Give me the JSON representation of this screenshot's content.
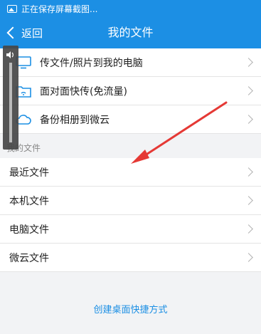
{
  "status_bar": {
    "text": "正在保存屏幕截图..."
  },
  "header": {
    "back_label": "返回",
    "title": "我的文件"
  },
  "transfer_items": [
    {
      "label": "传文件/照片到我的电脑",
      "icon": "monitor-icon"
    },
    {
      "label": "面对面快传(免流量)",
      "icon": "wifi-folder-icon"
    },
    {
      "label": "备份相册到微云",
      "icon": "cloud-icon"
    }
  ],
  "section_label": "我的文件",
  "file_items": [
    {
      "label": "最近文件"
    },
    {
      "label": "本机文件"
    },
    {
      "label": "电脑文件"
    },
    {
      "label": "微云文件"
    }
  ],
  "footer_link": "创建桌面快捷方式",
  "colors": {
    "accent": "#1c8fe4",
    "annotation_arrow": "#e53935"
  }
}
